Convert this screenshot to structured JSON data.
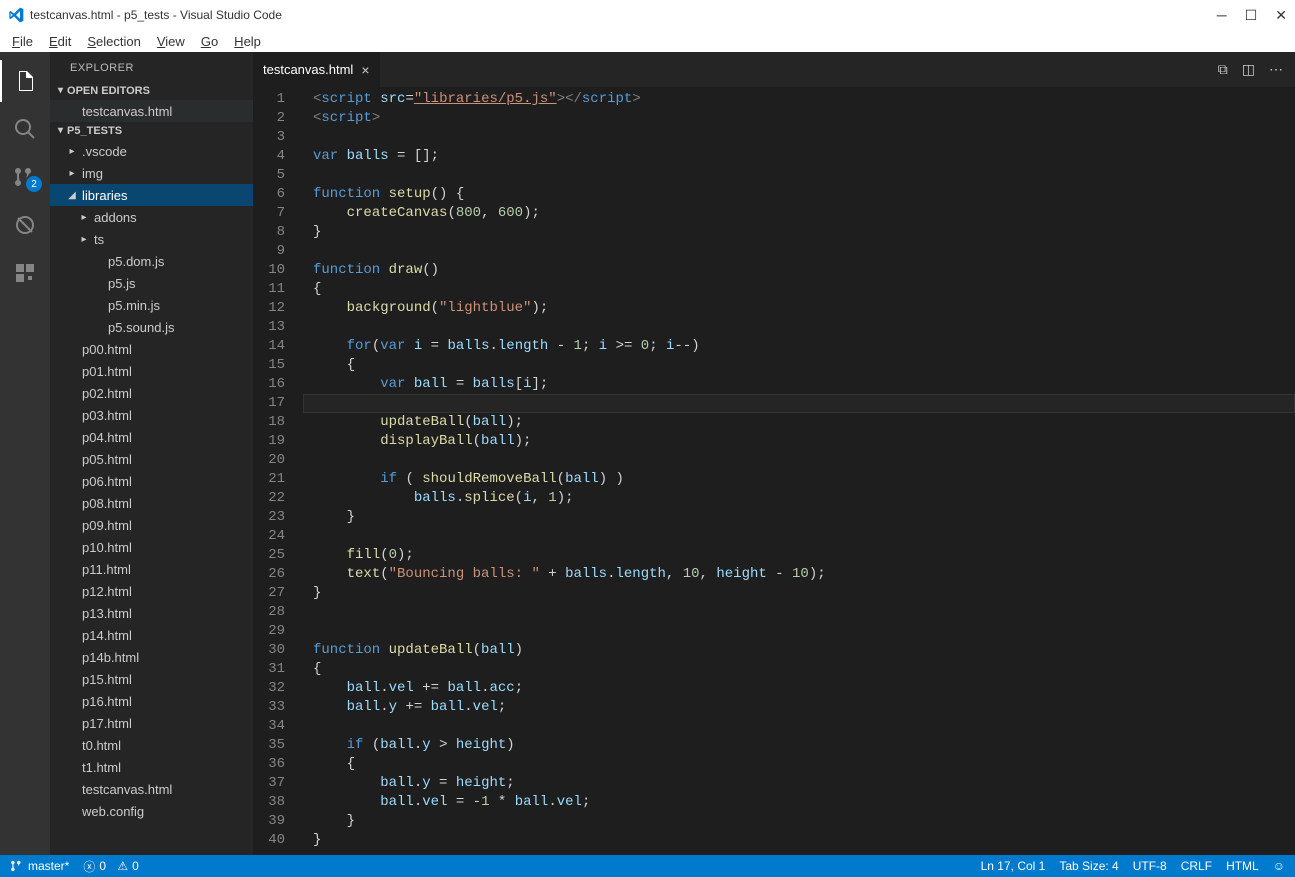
{
  "window": {
    "title": "testcanvas.html - p5_tests - Visual Studio Code"
  },
  "menu": [
    "File",
    "Edit",
    "Selection",
    "View",
    "Go",
    "Help"
  ],
  "activity_badge": "2",
  "sidebar": {
    "title": "EXPLORER",
    "open_editors_header": "OPEN EDITORS",
    "open_editors": [
      "testcanvas.html"
    ],
    "project_header": "P5_TESTS",
    "tree": [
      {
        "label": ".vscode",
        "indent": 1,
        "twisty": "▸"
      },
      {
        "label": "img",
        "indent": 1,
        "twisty": "▸"
      },
      {
        "label": "libraries",
        "indent": 1,
        "twisty": "◢",
        "selected": true
      },
      {
        "label": "addons",
        "indent": 2,
        "twisty": "▸"
      },
      {
        "label": "ts",
        "indent": 2,
        "twisty": "▸"
      },
      {
        "label": "p5.dom.js",
        "indent": 3,
        "twisty": ""
      },
      {
        "label": "p5.js",
        "indent": 3,
        "twisty": ""
      },
      {
        "label": "p5.min.js",
        "indent": 3,
        "twisty": ""
      },
      {
        "label": "p5.sound.js",
        "indent": 3,
        "twisty": ""
      },
      {
        "label": "p00.html",
        "indent": 1,
        "twisty": ""
      },
      {
        "label": "p01.html",
        "indent": 1,
        "twisty": ""
      },
      {
        "label": "p02.html",
        "indent": 1,
        "twisty": ""
      },
      {
        "label": "p03.html",
        "indent": 1,
        "twisty": ""
      },
      {
        "label": "p04.html",
        "indent": 1,
        "twisty": ""
      },
      {
        "label": "p05.html",
        "indent": 1,
        "twisty": ""
      },
      {
        "label": "p06.html",
        "indent": 1,
        "twisty": ""
      },
      {
        "label": "p08.html",
        "indent": 1,
        "twisty": ""
      },
      {
        "label": "p09.html",
        "indent": 1,
        "twisty": ""
      },
      {
        "label": "p10.html",
        "indent": 1,
        "twisty": ""
      },
      {
        "label": "p11.html",
        "indent": 1,
        "twisty": ""
      },
      {
        "label": "p12.html",
        "indent": 1,
        "twisty": ""
      },
      {
        "label": "p13.html",
        "indent": 1,
        "twisty": ""
      },
      {
        "label": "p14.html",
        "indent": 1,
        "twisty": ""
      },
      {
        "label": "p14b.html",
        "indent": 1,
        "twisty": ""
      },
      {
        "label": "p15.html",
        "indent": 1,
        "twisty": ""
      },
      {
        "label": "p16.html",
        "indent": 1,
        "twisty": ""
      },
      {
        "label": "p17.html",
        "indent": 1,
        "twisty": ""
      },
      {
        "label": "t0.html",
        "indent": 1,
        "twisty": ""
      },
      {
        "label": "t1.html",
        "indent": 1,
        "twisty": ""
      },
      {
        "label": "testcanvas.html",
        "indent": 1,
        "twisty": ""
      },
      {
        "label": "web.config",
        "indent": 1,
        "twisty": ""
      }
    ]
  },
  "tab": {
    "label": "testcanvas.html"
  },
  "editor": {
    "current_line": 17,
    "lines": [
      {
        "n": 1,
        "html": "<span class='angle'>&lt;</span><span class='tag'>script</span> <span class='attr'>src</span>=<span class='str underline'>\"libraries/p5.js\"</span><span class='angle'>&gt;&lt;/</span><span class='tag'>script</span><span class='angle'>&gt;</span>"
      },
      {
        "n": 2,
        "html": "<span class='angle'>&lt;</span><span class='tag'>script</span><span class='angle'>&gt;</span>"
      },
      {
        "n": 3,
        "html": ""
      },
      {
        "n": 4,
        "html": "<span class='kw'>var</span> <span class='var'>balls</span> <span class='op'>=</span> <span class='pun'>[];</span>"
      },
      {
        "n": 5,
        "html": ""
      },
      {
        "n": 6,
        "html": "<span class='kw'>function</span> <span class='fn'>setup</span><span class='pun'>() {</span>"
      },
      {
        "n": 7,
        "html": "    <span class='fn'>createCanvas</span><span class='pun'>(</span><span class='num'>800</span><span class='pun'>,</span> <span class='num'>600</span><span class='pun'>);</span>"
      },
      {
        "n": 8,
        "html": "<span class='pun'>}</span>"
      },
      {
        "n": 9,
        "html": ""
      },
      {
        "n": 10,
        "html": "<span class='kw'>function</span> <span class='fn'>draw</span><span class='pun'>()</span>"
      },
      {
        "n": 11,
        "html": "<span class='pun'>{</span>"
      },
      {
        "n": 12,
        "html": "    <span class='fn'>background</span><span class='pun'>(</span><span class='str'>\"lightblue\"</span><span class='pun'>);</span>"
      },
      {
        "n": 13,
        "html": ""
      },
      {
        "n": 14,
        "html": "    <span class='kw'>for</span><span class='pun'>(</span><span class='kw'>var</span> <span class='var'>i</span> <span class='op'>=</span> <span class='var'>balls</span><span class='pun'>.</span><span class='var'>length</span> <span class='op'>-</span> <span class='num'>1</span><span class='pun'>;</span> <span class='var'>i</span> <span class='op'>&gt;=</span> <span class='num'>0</span><span class='pun'>;</span> <span class='var'>i</span><span class='op'>--</span><span class='pun'>)</span>"
      },
      {
        "n": 15,
        "html": "    <span class='pun'>{</span>"
      },
      {
        "n": 16,
        "html": "        <span class='kw'>var</span> <span class='var'>ball</span> <span class='op'>=</span> <span class='var'>balls</span><span class='pun'>[</span><span class='var'>i</span><span class='pun'>];</span>"
      },
      {
        "n": 17,
        "html": ""
      },
      {
        "n": 18,
        "html": "        <span class='fn'>updateBall</span><span class='pun'>(</span><span class='var'>ball</span><span class='pun'>);</span>"
      },
      {
        "n": 19,
        "html": "        <span class='fn'>displayBall</span><span class='pun'>(</span><span class='var'>ball</span><span class='pun'>);</span>"
      },
      {
        "n": 20,
        "html": ""
      },
      {
        "n": 21,
        "html": "        <span class='kw'>if</span> <span class='pun'>(</span> <span class='fn'>shouldRemoveBall</span><span class='pun'>(</span><span class='var'>ball</span><span class='pun'>) )</span>"
      },
      {
        "n": 22,
        "html": "            <span class='var'>balls</span><span class='pun'>.</span><span class='fn'>splice</span><span class='pun'>(</span><span class='var'>i</span><span class='pun'>,</span> <span class='num'>1</span><span class='pun'>);</span>"
      },
      {
        "n": 23,
        "html": "    <span class='pun'>}</span>"
      },
      {
        "n": 24,
        "html": ""
      },
      {
        "n": 25,
        "html": "    <span class='fn'>fill</span><span class='pun'>(</span><span class='num'>0</span><span class='pun'>);</span>"
      },
      {
        "n": 26,
        "html": "    <span class='fn'>text</span><span class='pun'>(</span><span class='str'>\"Bouncing balls: \"</span> <span class='op'>+</span> <span class='var'>balls</span><span class='pun'>.</span><span class='var'>length</span><span class='pun'>,</span> <span class='num'>10</span><span class='pun'>,</span> <span class='var'>height</span> <span class='op'>-</span> <span class='num'>10</span><span class='pun'>);</span>"
      },
      {
        "n": 27,
        "html": "<span class='pun'>}</span>"
      },
      {
        "n": 28,
        "html": ""
      },
      {
        "n": 29,
        "html": ""
      },
      {
        "n": 30,
        "html": "<span class='kw'>function</span> <span class='fn'>updateBall</span><span class='pun'>(</span><span class='var'>ball</span><span class='pun'>)</span>"
      },
      {
        "n": 31,
        "html": "<span class='pun'>{</span>"
      },
      {
        "n": 32,
        "html": "    <span class='var'>ball</span><span class='pun'>.</span><span class='var'>vel</span> <span class='op'>+=</span> <span class='var'>ball</span><span class='pun'>.</span><span class='var'>acc</span><span class='pun'>;</span>"
      },
      {
        "n": 33,
        "html": "    <span class='var'>ball</span><span class='pun'>.</span><span class='var'>y</span> <span class='op'>+=</span> <span class='var'>ball</span><span class='pun'>.</span><span class='var'>vel</span><span class='pun'>;</span>"
      },
      {
        "n": 34,
        "html": ""
      },
      {
        "n": 35,
        "html": "    <span class='kw'>if</span> <span class='pun'>(</span><span class='var'>ball</span><span class='pun'>.</span><span class='var'>y</span> <span class='op'>&gt;</span> <span class='var'>height</span><span class='pun'>)</span>"
      },
      {
        "n": 36,
        "html": "    <span class='pun'>{</span>"
      },
      {
        "n": 37,
        "html": "        <span class='var'>ball</span><span class='pun'>.</span><span class='var'>y</span> <span class='op'>=</span> <span class='var'>height</span><span class='pun'>;</span>"
      },
      {
        "n": 38,
        "html": "        <span class='var'>ball</span><span class='pun'>.</span><span class='var'>vel</span> <span class='op'>=</span> <span class='op'>-</span><span class='num'>1</span> <span class='op'>*</span> <span class='var'>ball</span><span class='pun'>.</span><span class='var'>vel</span><span class='pun'>;</span>"
      },
      {
        "n": 39,
        "html": "    <span class='pun'>}</span>"
      },
      {
        "n": 40,
        "html": "<span class='pun'>}</span>"
      }
    ]
  },
  "status": {
    "branch": "master*",
    "errors": "0",
    "warnings": "0",
    "ln_col": "Ln 17, Col 1",
    "tab_size": "Tab Size: 4",
    "encoding": "UTF-8",
    "eol": "CRLF",
    "lang": "HTML"
  }
}
